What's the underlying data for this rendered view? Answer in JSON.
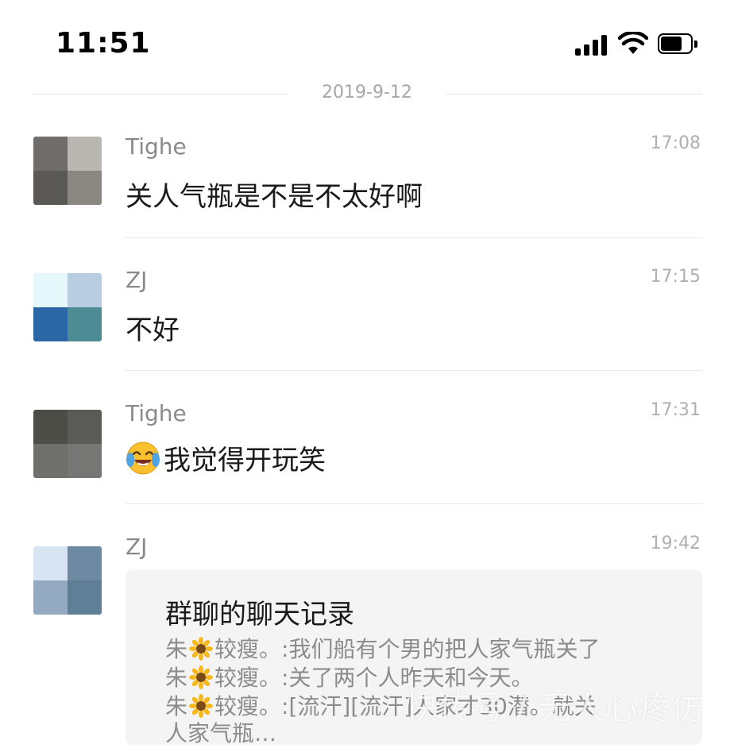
{
  "status_bar": {
    "time": "11:51",
    "signal_icon": "cellular-signal-icon",
    "wifi_icon": "wifi-icon",
    "battery_icon": "battery-icon"
  },
  "date_divider": "2019-9-12",
  "messages": [
    {
      "sender": "Tighe",
      "time": "17:08",
      "text": "关人气瓶是不是不太好啊",
      "avatar_colors": [
        "#6f6d6b",
        "#b9b7b2",
        "#5a5955",
        "#8a8680"
      ]
    },
    {
      "sender": "ZJ",
      "time": "17:15",
      "text": "不好",
      "avatar_colors": [
        "#e6f8fb",
        "#b8cde2",
        "#2b67a5",
        "#4d8b95"
      ]
    },
    {
      "sender": "Tighe",
      "time": "17:31",
      "text": "我觉得开玩笑",
      "emoji": "crying-laughing-face-icon",
      "avatar_colors": [
        "#4d4d47",
        "#5a5a56",
        "#6f6f6c",
        "#767674"
      ]
    },
    {
      "sender": "ZJ",
      "time": "19:42",
      "avatar_colors": [
        "#d8e4f2",
        "#6d8aa2",
        "#94aac1",
        "#5f7f96"
      ]
    }
  ],
  "chat_record": {
    "title": "群聊的聊天记录",
    "lines": [
      {
        "name_start": "朱",
        "icon": "sunflower-icon",
        "name_end": "较瘦。",
        "text": ":我们船有个男的把人家气瓶关了"
      },
      {
        "name_start": "朱",
        "icon": "sunflower-icon",
        "name_end": "较瘦。",
        "text": ":关了两个人昨天和今天。"
      },
      {
        "name_start": "朱",
        "icon": "sunflower-icon",
        "name_end": "较瘦。",
        "text": ":[流汗][流汗]人家才30潜。就关"
      },
      {
        "name_start": "",
        "icon": "",
        "name_end": "",
        "text": "人家气瓶…"
      }
    ]
  },
  "watermark": "快传号 / 无人心疼仿"
}
